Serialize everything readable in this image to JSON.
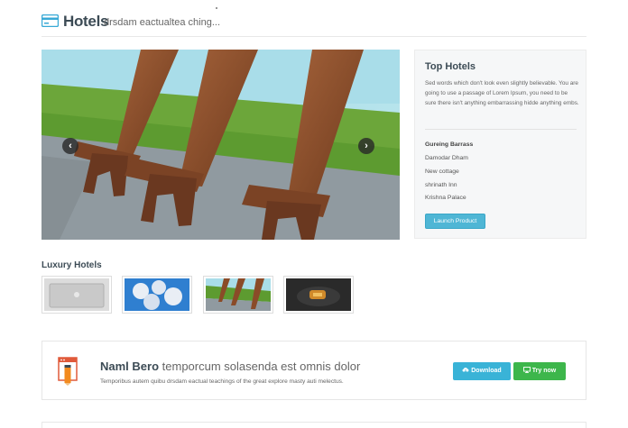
{
  "header": {
    "title": "Hotels",
    "subtitle": "drsdam eactualtea ching..."
  },
  "slider": {
    "prev_label": "‹",
    "next_label": "›"
  },
  "top_hotels": {
    "title": "Top Hotels",
    "description": "Sed words which don't look even slightly believable. You are going to use a passage of Lorem Ipsum, you need to be sure there isn't anything embarrassing hidde anything embs.",
    "list_heading": "Gureing Barrass",
    "items": [
      "Damodar Dham",
      "New cottage",
      "shrinath Inn",
      "Krishna Palace"
    ],
    "button_label": "Launch Product"
  },
  "luxury": {
    "title": "Luxury Hotels"
  },
  "promo": {
    "title_bold": "Naml Bero",
    "title_rest": "temporcum solasenda est omnis dolor",
    "text": "Temporibus autem quibu drsdam eactual teachings of the great explore masty auti melectus.",
    "download_label": "Download",
    "try_label": "Try now"
  },
  "colors": {
    "accent": "#39b3d7",
    "success": "#3db64b",
    "heading": "#3c4b55"
  }
}
